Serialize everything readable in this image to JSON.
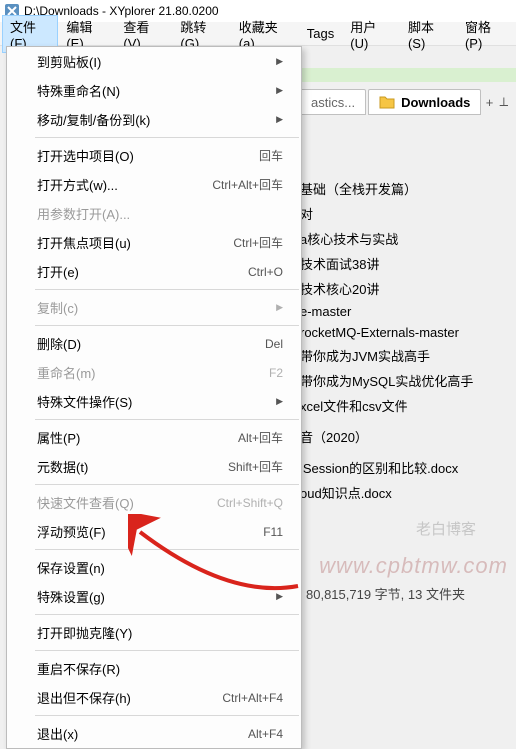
{
  "title": "D:\\Downloads - XYplorer 21.80.0200",
  "menubar": [
    "文件(F)",
    "编辑(E)",
    "查看(V)",
    "跳转(G)",
    "收藏夹(a)",
    "Tags",
    "用户(U)",
    "脚本(S)",
    "窗格(P)"
  ],
  "tabs": {
    "inactive_suffix": "astics...",
    "active": "Downloads",
    "plus": "+",
    "pin": "⟂"
  },
  "files": [
    "基础（全栈开发篇）",
    "对",
    "a核心技术与实战",
    "技术面试38讲",
    "技术核心20讲",
    "e-master",
    "rocketMQ-Externals-master",
    "带你成为JVM实战高手",
    "带你成为MySQL实战优化高手",
    "xcel文件和csv文件",
    "",
    "音（2020）",
    "",
    "lSession的区别和比较.docx",
    "oud知识点.docx"
  ],
  "status": "80,815,719 字节, 13 文件夹",
  "watermark1": "老白博客",
  "watermark2": "www.cpbtmw.com",
  "menu": {
    "items": [
      {
        "label": "到剪贴板(I)",
        "shortcut": "",
        "sub": true
      },
      {
        "label": "特殊重命名(N)",
        "shortcut": "",
        "sub": true
      },
      {
        "label": "移动/复制/备份到(k)",
        "shortcut": "",
        "sub": true
      },
      {
        "sep": true
      },
      {
        "label": "打开选中项目(O)",
        "shortcut": "回车"
      },
      {
        "label": "打开方式(w)...",
        "shortcut": "Ctrl+Alt+回车"
      },
      {
        "label": "用参数打开(A)...",
        "shortcut": "",
        "disabled": true
      },
      {
        "label": "打开焦点项目(u)",
        "shortcut": "Ctrl+回车"
      },
      {
        "label": "打开(e)",
        "shortcut": "Ctrl+O"
      },
      {
        "sep": true
      },
      {
        "label": "复制(c)",
        "shortcut": "",
        "disabled": true,
        "sub": true
      },
      {
        "sep": true
      },
      {
        "label": "删除(D)",
        "shortcut": "Del"
      },
      {
        "label": "重命名(m)",
        "shortcut": "F2",
        "disabled": true
      },
      {
        "label": "特殊文件操作(S)",
        "shortcut": "",
        "sub": true
      },
      {
        "sep": true
      },
      {
        "label": "属性(P)",
        "shortcut": "Alt+回车"
      },
      {
        "label": "元数据(t)",
        "shortcut": "Shift+回车"
      },
      {
        "sep": true
      },
      {
        "label": "快速文件查看(Q)",
        "shortcut": "Ctrl+Shift+Q",
        "disabled": true
      },
      {
        "label": "浮动预览(F)",
        "shortcut": "F11"
      },
      {
        "sep": true
      },
      {
        "label": "保存设置(n)",
        "shortcut": ""
      },
      {
        "label": "特殊设置(g)",
        "shortcut": "",
        "sub": true
      },
      {
        "sep": true
      },
      {
        "label": "打开即抛克隆(Y)",
        "shortcut": ""
      },
      {
        "sep": true
      },
      {
        "label": "重启不保存(R)",
        "shortcut": ""
      },
      {
        "label": "退出但不保存(h)",
        "shortcut": "Ctrl+Alt+F4"
      },
      {
        "sep": true
      },
      {
        "label": "退出(x)",
        "shortcut": "Alt+F4"
      }
    ]
  }
}
